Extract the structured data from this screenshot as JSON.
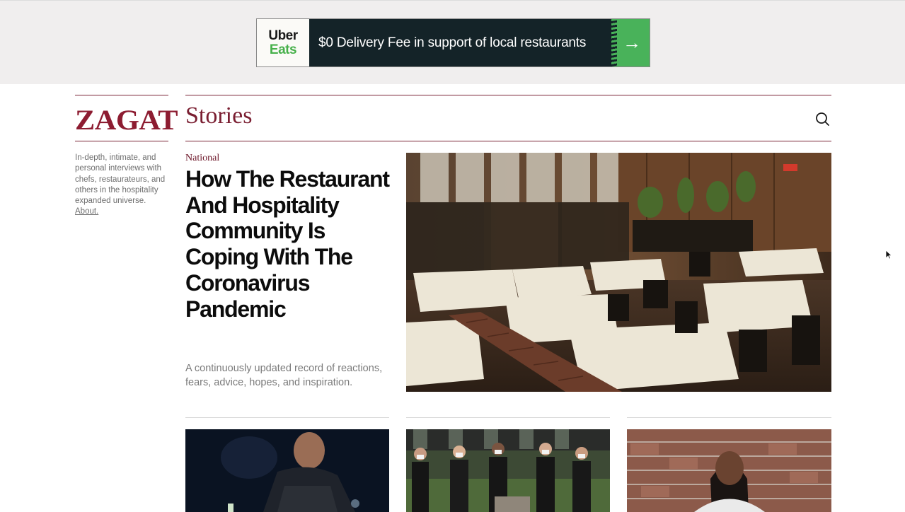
{
  "ad": {
    "logo_line1": "Uber",
    "logo_line2": "Eats",
    "text": "$0 Delivery Fee in support of local restaurants",
    "arrow": "→",
    "brand_green": "#47b04b",
    "dark_bg": "#142328"
  },
  "header": {
    "logo": "ZAGAT",
    "section_title": "Stories",
    "search_icon": "search-icon",
    "accent": "#8d1c31"
  },
  "sidebar": {
    "intro": "In-depth, intimate, and personal interviews with chefs, restaurateurs, and others in the hospitality expanded universe.",
    "about_link": "About."
  },
  "feature": {
    "kicker": "National",
    "headline": "How The Restaurant And Hospitality Community Is Coping With The Coronavirus Pandemic",
    "dek": "A continuously updated record of reactions, fears, advice, hopes, and inspiration."
  }
}
